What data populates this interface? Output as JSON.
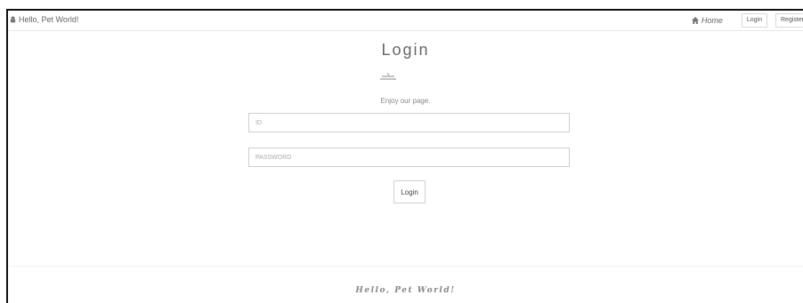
{
  "header": {
    "brand_icon": "paw-icon",
    "brand_text": "Hello, Pet World!",
    "home_icon": "home-icon",
    "home_label": "Home",
    "login_label": "Login",
    "register_label": "Register"
  },
  "main": {
    "title": "Login",
    "divider_icon": "pen-divider-icon",
    "subtitle": "Enjoy our page.",
    "id_placeholder": "ID",
    "password_placeholder": "PASSWORD",
    "login_button": "Login"
  },
  "footer": {
    "text": "Hello, Pet World!"
  },
  "colors": {
    "background": "#ffffff",
    "text": "#666666",
    "border": "#d0d0d0"
  }
}
